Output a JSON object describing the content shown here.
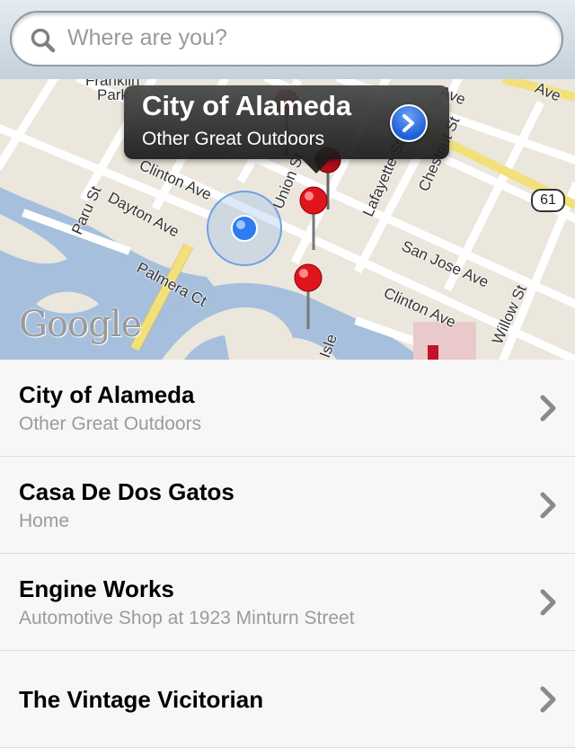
{
  "search": {
    "placeholder": "Where are you?",
    "icon": "search-icon"
  },
  "map": {
    "attribution": "Google",
    "route_shield": "61",
    "streets": {
      "franklin": "Franklin",
      "park": "Park",
      "ave_top": "Ave",
      "ave_right": "Ave",
      "clinton_top": "Clinton Ave",
      "union": "Union St",
      "lafayette": "Lafayette St",
      "chestnut": "Chestnut St",
      "paru": "Paru St",
      "dayton": "Dayton Ave",
      "palmera": "Palmera Ct",
      "san_jose": "San Jose Ave",
      "clinton_bottom": "Clinton Ave",
      "willow": "Willow St",
      "isle": "Isle"
    },
    "callout": {
      "title": "City of Alameda",
      "subtitle": "Other Great Outdoors"
    },
    "colors": {
      "water": "#a6bfdd",
      "pin": "#e0141c",
      "user_location": "#2f7bf0",
      "highway": "#f2e07a"
    }
  },
  "places": [
    {
      "title": "City of Alameda",
      "subtitle": "Other Great Outdoors"
    },
    {
      "title": "Casa De Dos Gatos",
      "subtitle": "Home"
    },
    {
      "title": "Engine Works",
      "subtitle": "Automotive Shop at 1923 Minturn Street"
    },
    {
      "title": "The Vintage Vicitorian",
      "subtitle": ""
    }
  ]
}
